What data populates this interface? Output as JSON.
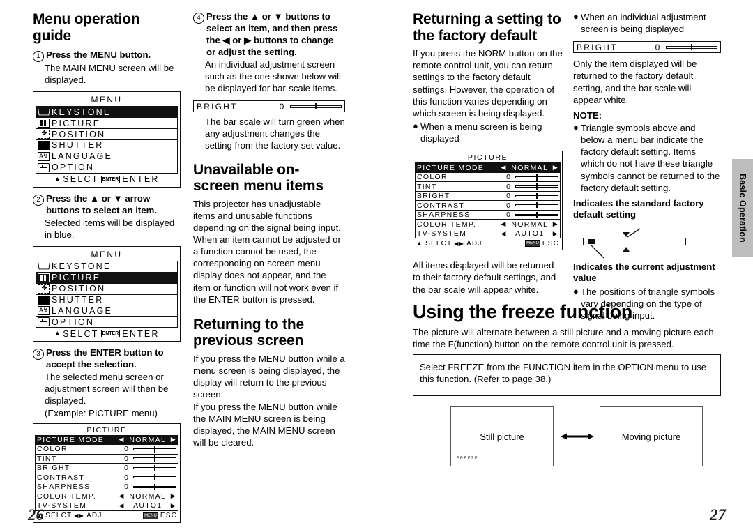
{
  "document": {
    "page_left": "26",
    "page_right": "27",
    "side_tab": "Basic Operation"
  },
  "col1": {
    "heading": "Menu operation guide",
    "step1": {
      "num": "1",
      "bold": "Press the MENU button.",
      "sub": "The MAIN MENU screen will be displayed."
    },
    "step2": {
      "num": "2",
      "bold": "Press the ▲ or ▼ arrow buttons to select an item.",
      "sub": "Selected items will be displayed in blue."
    },
    "step3": {
      "num": "3",
      "bold": "Press the ENTER button to accept the selection.",
      "sub": "The selected menu screen or adjustment screen will then be displayed.",
      "sub2": "(Example: PICTURE menu)"
    },
    "menu_osd_1": {
      "title": "MENU",
      "selected_index": 0,
      "items": [
        {
          "label": "KEYSTONE",
          "icon": "keystone-icon"
        },
        {
          "label": "PICTURE",
          "icon": "picture-icon"
        },
        {
          "label": "POSITION",
          "icon": "position-icon"
        },
        {
          "label": "SHUTTER",
          "icon": "shutter-icon"
        },
        {
          "label": "LANGUAGE",
          "icon": "language-icon"
        },
        {
          "label": "OPTION",
          "icon": "option-icon"
        }
      ],
      "footer_select": "SELCT",
      "footer_key": "ENTER",
      "footer_enter": "ENTER"
    },
    "menu_osd_2": {
      "title": "MENU",
      "selected_index": 1,
      "items": [
        {
          "label": "KEYSTONE",
          "icon": "keystone-icon"
        },
        {
          "label": "PICTURE",
          "icon": "picture-icon"
        },
        {
          "label": "POSITION",
          "icon": "position-icon"
        },
        {
          "label": "SHUTTER",
          "icon": "shutter-icon"
        },
        {
          "label": "LANGUAGE",
          "icon": "language-icon"
        },
        {
          "label": "OPTION",
          "icon": "option-icon"
        }
      ],
      "footer_select": "SELCT",
      "footer_key": "ENTER",
      "footer_enter": "ENTER"
    }
  },
  "picture_osd": {
    "title": "PICTURE",
    "rows": [
      {
        "name": "PICTURE MODE",
        "value": "NORMAL",
        "type": "choice",
        "selected": true
      },
      {
        "name": "COLOR",
        "value": "0",
        "type": "bar"
      },
      {
        "name": "TINT",
        "value": "0",
        "type": "bar"
      },
      {
        "name": "BRIGHT",
        "value": "0",
        "type": "bar"
      },
      {
        "name": "CONTRAST",
        "value": "0",
        "type": "bar"
      },
      {
        "name": "SHARPNESS",
        "value": "0",
        "type": "bar"
      },
      {
        "name": "COLOR TEMP.",
        "value": "NORMAL",
        "type": "choice"
      },
      {
        "name": "TV-SYSTEM",
        "value": "AUTO1",
        "type": "choice"
      }
    ],
    "footer_select": "SELCT",
    "footer_adj": "ADJ",
    "footer_key": "MENU",
    "footer_esc": "ESC"
  },
  "col2": {
    "step4": {
      "num": "4",
      "bold": "Press the ▲ or ▼ buttons to select an item, and then press the ◀ or ▶ buttons to change or adjust the setting.",
      "sub": "An individual adjustment screen such as the one shown below will be displayed for bar-scale items."
    },
    "bright_bar": {
      "name": "BRIGHT",
      "value": "0"
    },
    "after_bar": "The bar scale will turn green when any adjustment changes the setting from the factory set value.",
    "heading2": "Unavailable on-screen menu items",
    "body2": "This projector has unadjustable items and unusable functions depending on the signal being input. When an item cannot be adjusted or a function cannot be used, the corresponding on-screen menu display does not appear, and the item or function will not work even if the ENTER button is pressed.",
    "heading3": "Returning to the previous screen",
    "body3a": "If you press the MENU button while a menu screen is being displayed, the display will return to the previous screen.",
    "body3b": "If you press the MENU button while the MAIN MENU screen is being displayed, the MAIN MENU screen will be cleared."
  },
  "col3": {
    "heading": "Returning a setting to the factory default",
    "body": "If you press the NORM button on the remote control unit, you can return settings to the factory default settings. However, the operation of this function varies depending on which screen is being displayed.",
    "bullet1": "When a menu screen is being displayed",
    "after": "All items displayed will be returned to their factory default settings, and the bar scale will appear white."
  },
  "col4": {
    "bullet1": "When an individual adjustment screen is being displayed",
    "bright_bar": {
      "name": "BRIGHT",
      "value": "0"
    },
    "body": "Only the item displayed will be returned to the factory default setting, and the bar scale will appear white.",
    "note_head": "NOTE:",
    "note_bullet": "Triangle symbols above and below a menu bar indicate the factory default setting. Items which do not have these triangle symbols cannot be returned to the factory default setting.",
    "caption_top": "Indicates the standard factory default setting",
    "caption_bottom": "Indicates the current adjustment value",
    "last_bullet": "The positions of triangle symbols vary depending on the type of signal being input."
  },
  "freeze": {
    "heading": "Using the freeze function",
    "body": "The picture will alternate between a still picture and a moving picture each time the F(function) button on the remote control unit is pressed.",
    "boxed_note": "Select FREEZE from the FUNCTION item in the OPTION menu to use this function. (Refer to page 38.)",
    "still_label": "Still picture",
    "moving_label": "Moving picture",
    "osd_freeze_label": "FREEZE"
  }
}
